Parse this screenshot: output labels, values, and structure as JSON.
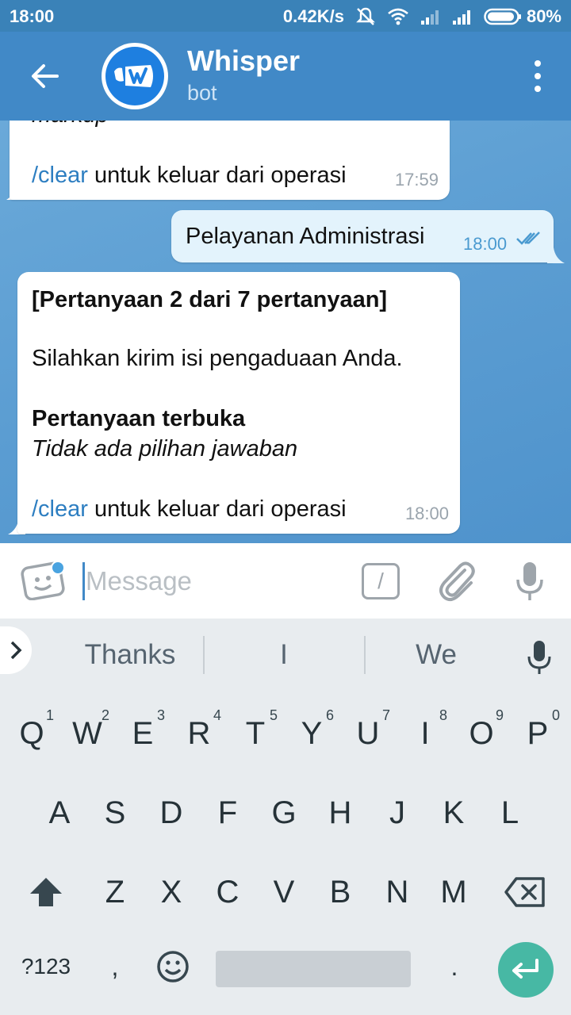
{
  "status_bar": {
    "time": "18:00",
    "network_speed": "0.42K/s",
    "battery": "80%"
  },
  "header": {
    "title": "Whisper",
    "subtitle": "bot"
  },
  "messages": {
    "m1": {
      "partial_text": "markup",
      "command": "/clear",
      "rest": " untuk keluar dari operasi",
      "time": "17:59"
    },
    "m2": {
      "text": "Pelayanan Administrasi",
      "time": "18:00"
    },
    "m3": {
      "line1": "[Pertanyaan 2 dari 7 pertanyaan]",
      "line2": "Silahkan kirim isi pengaduaan Anda.",
      "line3": "Pertanyaan terbuka",
      "line4": "Tidak ada pilihan jawaban",
      "command": "/clear",
      "rest": " untuk keluar dari operasi",
      "time": "18:00"
    }
  },
  "input": {
    "placeholder": "Message",
    "value": "",
    "slash_label": "/"
  },
  "suggestions": [
    "Thanks",
    "I",
    "We"
  ],
  "keyboard": {
    "row1": [
      "Q",
      "W",
      "E",
      "R",
      "T",
      "Y",
      "U",
      "I",
      "O",
      "P"
    ],
    "row1_hints": [
      "1",
      "2",
      "3",
      "4",
      "5",
      "6",
      "7",
      "8",
      "9",
      "0"
    ],
    "row2": [
      "A",
      "S",
      "D",
      "F",
      "G",
      "H",
      "J",
      "K",
      "L"
    ],
    "row3": [
      "Z",
      "X",
      "C",
      "V",
      "B",
      "N",
      "M"
    ],
    "symbols_label": "?123",
    "comma": ",",
    "period": "."
  },
  "colors": {
    "header": "#4189c7",
    "status_bar": "#3a82b8",
    "outgoing_bubble": "#e3f3fc",
    "command_link": "#2d7ec1",
    "enter_key": "#47b8a4"
  }
}
